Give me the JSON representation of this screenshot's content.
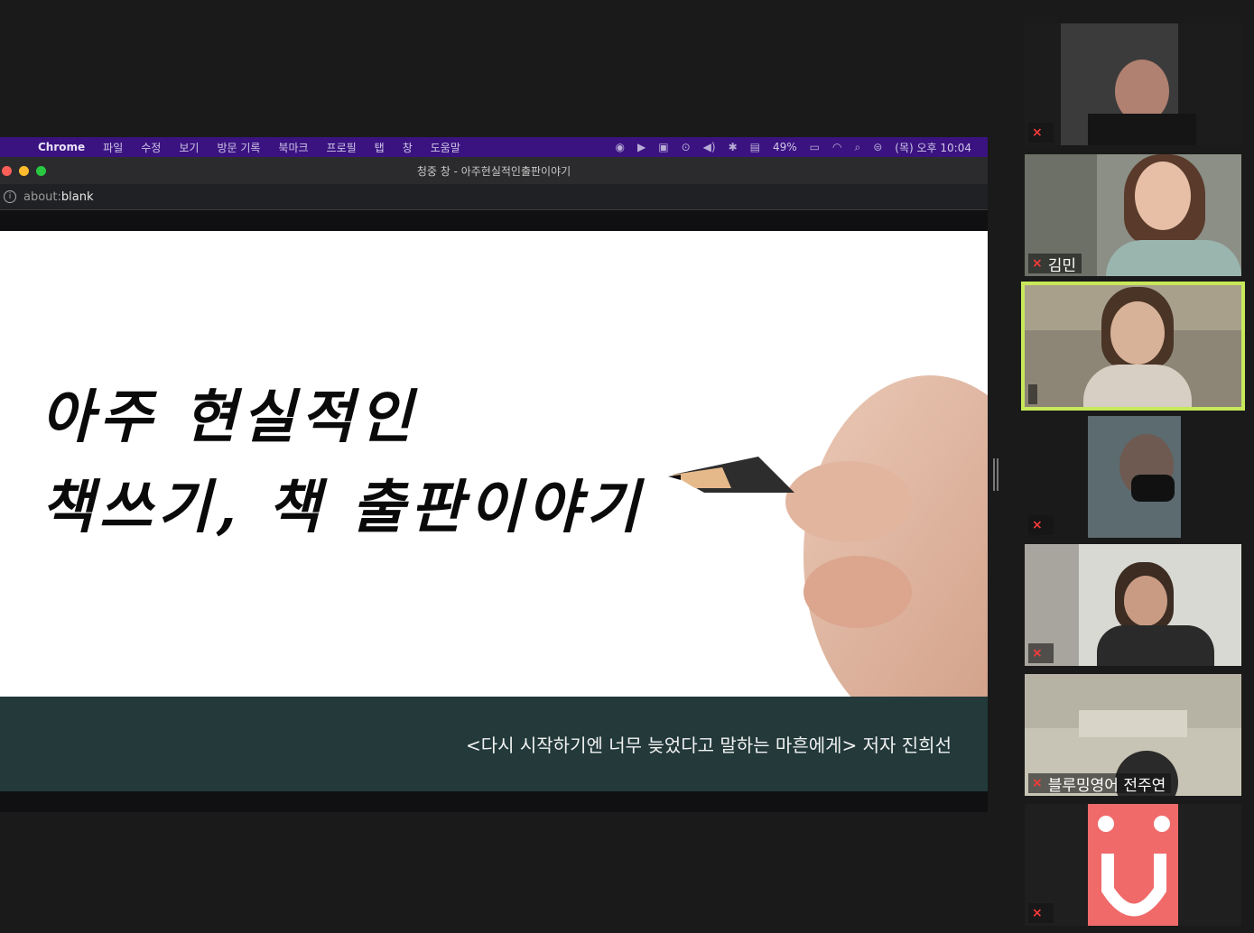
{
  "menubar": {
    "app": "Chrome",
    "items": [
      "파일",
      "수정",
      "보기",
      "방문 기록",
      "북마크",
      "프로필",
      "탭",
      "창",
      "도움말"
    ],
    "battery": "49%",
    "clock": "(목) 오후 10:04"
  },
  "window": {
    "title": "청중 창 - 아주현실적인출판이야기",
    "address_prefix": "about:",
    "address_main": "blank"
  },
  "slide": {
    "line1": "아주 현실적인",
    "line2": "책쓰기, 책 출판이야기",
    "footer": "<다시 시작하기엔 너무 늦었다고 말하는 마흔에게> 저자 진희선"
  },
  "participants": [
    {
      "name": ""
    },
    {
      "name": "김민"
    },
    {
      "name": ""
    },
    {
      "name": ""
    },
    {
      "name": ""
    },
    {
      "name": "블루밍영어 전주연"
    },
    {
      "name": ""
    }
  ],
  "colors": {
    "menubar": "#3a1380",
    "slide_footer": "#23393a",
    "active_speaker": "#c8e85a",
    "muted_icon": "#ff3b3b"
  }
}
